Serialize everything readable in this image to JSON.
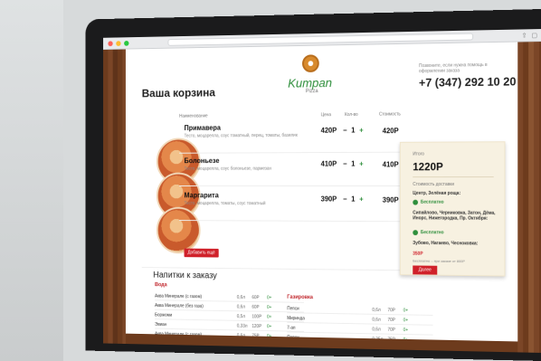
{
  "header": {
    "title": "Ваша корзина",
    "logo": "Kumpan",
    "logo_sub": "Pizza",
    "phone_note": "Позвоните, если нужна помощь в оформлении заказа",
    "phone": "+7 (347) 292 10 20"
  },
  "table": {
    "headers": [
      "Наименование",
      "Цена",
      "Кол-во",
      "Стоимость"
    ],
    "items": [
      {
        "name": "Примавера",
        "desc": "Тесто, моцарелла, соус томатный, перец, томаты, базилик",
        "price": "420Р",
        "qty": "1",
        "cost": "420Р"
      },
      {
        "name": "Болоньезе",
        "desc": "Тесто, моцарелла, соус болоньезе, пармезан",
        "price": "410Р",
        "qty": "1",
        "cost": "410Р"
      },
      {
        "name": "Маргарита",
        "desc": "Тесто, моцарелла, томаты, соус томатный",
        "price": "390Р",
        "qty": "1",
        "cost": "390Р"
      }
    ],
    "add_label": "Добавить ещё"
  },
  "drinks": {
    "title": "Напитки к заказу",
    "left_title": "Вода",
    "left": [
      {
        "name": "Аква Минерале (с газом)",
        "volume": "0,6л",
        "price": "60Р",
        "qty": "0+"
      },
      {
        "name": "Аква Минерале (без газа)",
        "volume": "0,6л",
        "price": "60Р",
        "qty": "0+"
      },
      {
        "name": "Боржоми",
        "volume": "0,5л",
        "price": "100Р",
        "qty": "0+"
      },
      {
        "name": "Эвиан",
        "volume": "0,33л",
        "price": "120Р",
        "qty": "0+"
      },
      {
        "name": "Аква Минерале (с газом)",
        "volume": "0,6л",
        "price": "75Р",
        "qty": "0+"
      }
    ],
    "right_title": "Газировка",
    "right": [
      {
        "name": "Пепси",
        "volume": "0,6л",
        "price": "70Р",
        "qty": "0+"
      },
      {
        "name": "Миринда",
        "volume": "0,6л",
        "price": "70Р",
        "qty": "0+"
      },
      {
        "name": "7-ап",
        "volume": "0,6л",
        "price": "70Р",
        "qty": "0+"
      },
      {
        "name": "Пепси",
        "volume": "0,25л",
        "price": "75Р",
        "qty": "0+"
      },
      {
        "name": "Миринда",
        "volume": "0,25л",
        "price": "75Р",
        "qty": "0+"
      }
    ]
  },
  "summary": {
    "total_label": "Итого",
    "total": "1220Р",
    "delivery_label": "Стоимость доставки",
    "area1": "Центр, Зелёная роща:",
    "free": "Бесплатно",
    "area2": "Сипайлово, Черниковка, Затон, Дёма, Инорс, Нижегородка, Пр. Октября:",
    "area3": "Зубово, Нагаево, Чесноковка:",
    "paid_price": "350Р",
    "note": "Бесплатно – при заказе от 800Р",
    "next_label": "Далее"
  },
  "colors": {
    "accent": "#d0212a",
    "green": "#2f8f3c",
    "wood": "#6d3b1d"
  }
}
